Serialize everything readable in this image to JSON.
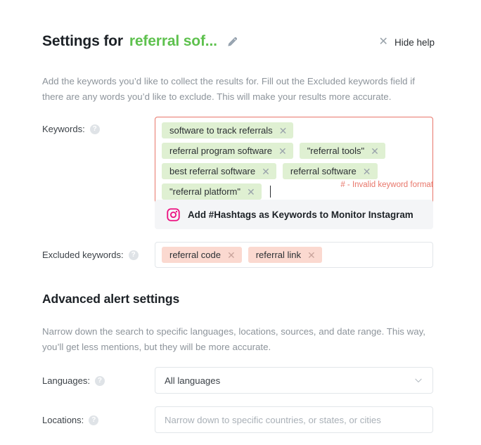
{
  "header": {
    "title_static": "Settings for",
    "title_dynamic": "referral sof...",
    "edit_icon": "pencil-icon",
    "hide_help_label": "Hide help",
    "hide_help_icon": "close-icon",
    "accent_green": "#5ec14e"
  },
  "intro": {
    "paragraph": "Add the keywords you’d like to collect the results for. Fill out the Excluded keywords field if there are any words you’d like to exclude. This will make your results more accurate."
  },
  "keywords_field": {
    "label": "Keywords:",
    "help_icon": "question-mark-icon",
    "tags": [
      {
        "text": "software to track referrals",
        "remove_icon": "close-icon"
      },
      {
        "text": "referral program software",
        "remove_icon": "close-icon"
      },
      {
        "text": "\"referral tools\"",
        "remove_icon": "close-icon"
      },
      {
        "text": "best referral software",
        "remove_icon": "close-icon"
      },
      {
        "text": "referral software",
        "remove_icon": "close-icon"
      },
      {
        "text": "\"referral platform\"",
        "remove_icon": "close-icon"
      }
    ],
    "input_value": "",
    "error_text": "# - Invalid keyword format",
    "border_color": "#e8766a",
    "tag_background": "#dff0d2"
  },
  "instagram_banner": {
    "icon": "instagram-icon",
    "label": "Add #Hashtags as Keywords to Monitor Instagram",
    "icon_color": "#ec1080",
    "background": "#f4f5f7"
  },
  "excluded_field": {
    "label": "Excluded keywords:",
    "help_icon": "question-mark-icon",
    "tags": [
      {
        "text": "referral code",
        "remove_icon": "close-icon"
      },
      {
        "text": "referral link",
        "remove_icon": "close-icon"
      }
    ],
    "tag_background": "#fbd9d0"
  },
  "advanced": {
    "section_title": "Advanced alert settings",
    "paragraph": "Narrow down the search to specific languages, locations, sources, and date range. This way, you’ll get less mentions, but they will be more accurate.",
    "languages": {
      "label": "Languages:",
      "help_icon": "question-mark-icon",
      "value": "All languages",
      "chevron_icon": "chevron-down-icon"
    },
    "locations": {
      "label": "Locations:",
      "help_icon": "question-mark-icon",
      "value": "",
      "placeholder": "Narrow down to specific countries, or states, or cities"
    }
  }
}
